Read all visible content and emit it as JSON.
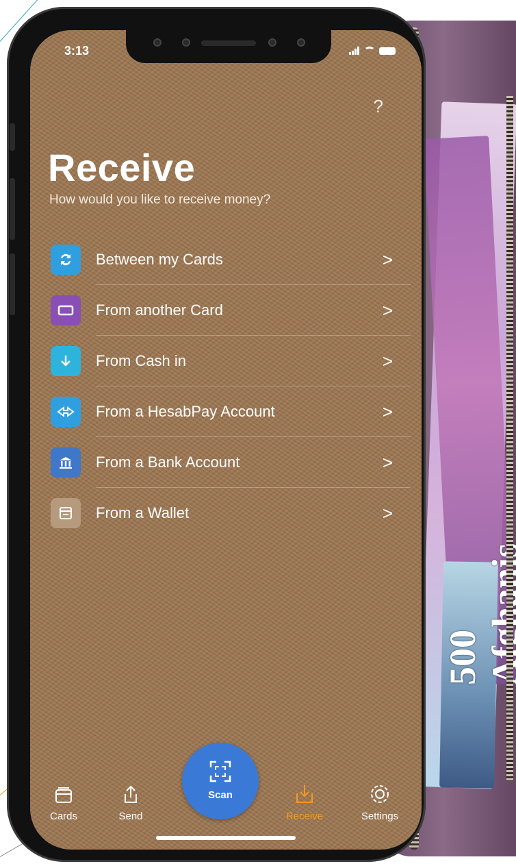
{
  "status_bar": {
    "time": "3:13"
  },
  "header": {
    "help_label": "?",
    "title": "Receive",
    "subtitle": "How would you like to receive money?"
  },
  "menu": {
    "items": [
      {
        "label": "Between my Cards",
        "icon": "swap-cards-icon",
        "color": "#2f9fe0"
      },
      {
        "label": "From another Card",
        "icon": "card-icon",
        "color": "#8a4fb5"
      },
      {
        "label": "From Cash in",
        "icon": "arrow-down-icon",
        "color": "#2eb3dc"
      },
      {
        "label": "From a HesabPay Account",
        "icon": "hesabpay-icon",
        "color": "#2f9fe0"
      },
      {
        "label": "From a Bank Account",
        "icon": "bank-icon",
        "color": "#3f78c8"
      },
      {
        "label": "From a Wallet",
        "icon": "wallet-icon",
        "color": "#b69a7e"
      }
    ],
    "chevron": ">"
  },
  "tabbar": {
    "tabs": [
      {
        "label": "Cards",
        "icon": "cards-icon"
      },
      {
        "label": "Send",
        "icon": "share-icon"
      },
      {
        "label": "Scan",
        "icon": "scan-icon"
      },
      {
        "label": "Receive",
        "icon": "receive-icon",
        "active": true
      },
      {
        "label": "Settings",
        "icon": "gear-icon"
      }
    ],
    "active_color": "#f39a1e"
  },
  "background": {
    "banknote_text": "500 Afghanis"
  }
}
